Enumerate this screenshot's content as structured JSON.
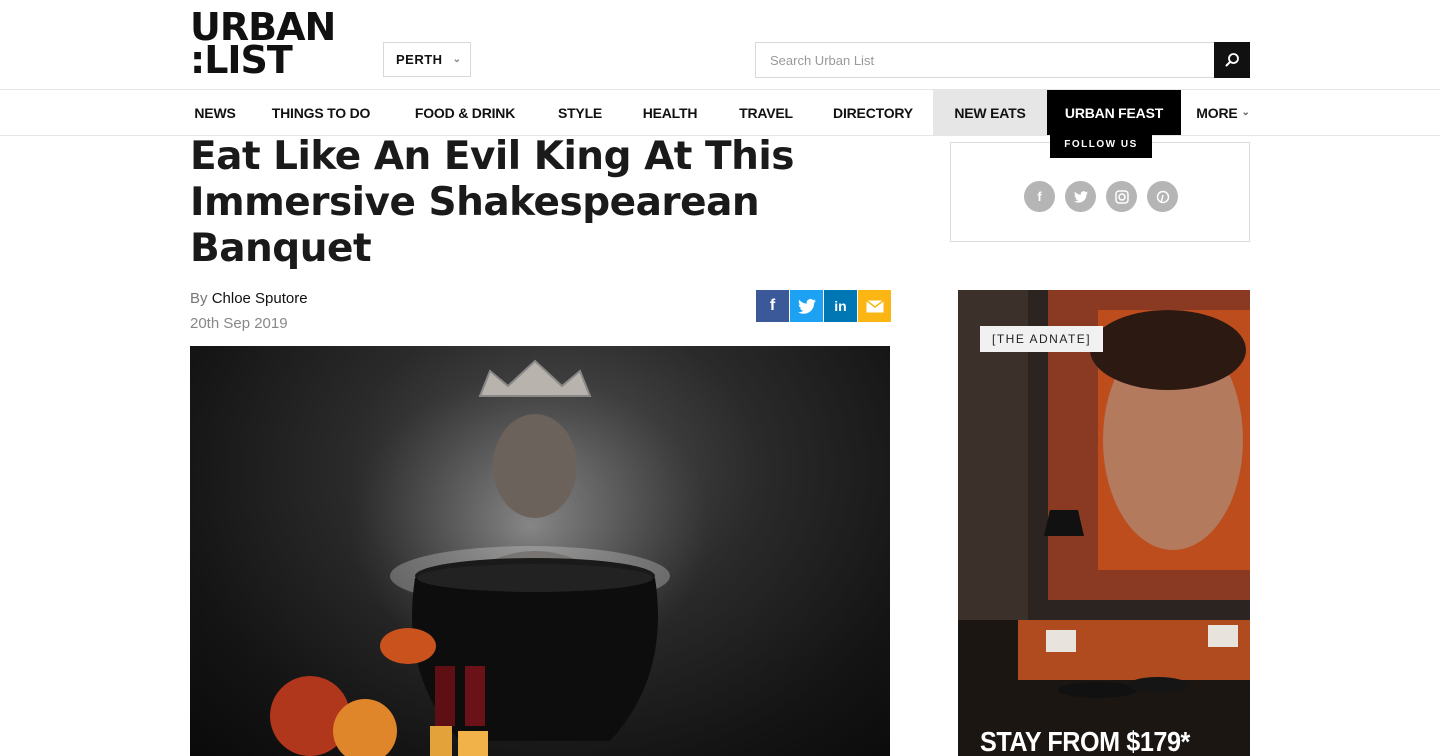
{
  "header": {
    "logo_line1": "URBAN",
    "logo_line2": ":LIST",
    "city": "PERTH",
    "search_placeholder": "Search Urban List"
  },
  "nav": {
    "items": [
      "NEWS",
      "THINGS TO DO",
      "FOOD & DRINK",
      "STYLE",
      "HEALTH",
      "TRAVEL",
      "DIRECTORY",
      "NEW EATS",
      "URBAN FEAST",
      "MORE"
    ]
  },
  "article": {
    "title": "Eat Like An Evil King At This Immersive Shakespearean Banquet",
    "by_prefix": "By",
    "author": "Chloe Sputore",
    "date": "20th Sep 2019"
  },
  "share_icons": [
    "facebook-icon",
    "twitter-icon",
    "linkedin-icon",
    "email-icon"
  ],
  "sidebar": {
    "follow_label": "FOLLOW US",
    "social_icons": [
      "facebook-icon",
      "twitter-icon",
      "instagram-icon",
      "pinterest-icon"
    ]
  },
  "ad": {
    "tag": "[THE ADNATE]",
    "cta": "STAY FROM $179*"
  },
  "colors": {
    "facebook": "#3b5998",
    "twitter": "#1da1f2",
    "linkedin": "#0077b5",
    "email": "#fbb614",
    "nav_active_bg": "#e6e6e6",
    "feast_bg": "#000000"
  }
}
